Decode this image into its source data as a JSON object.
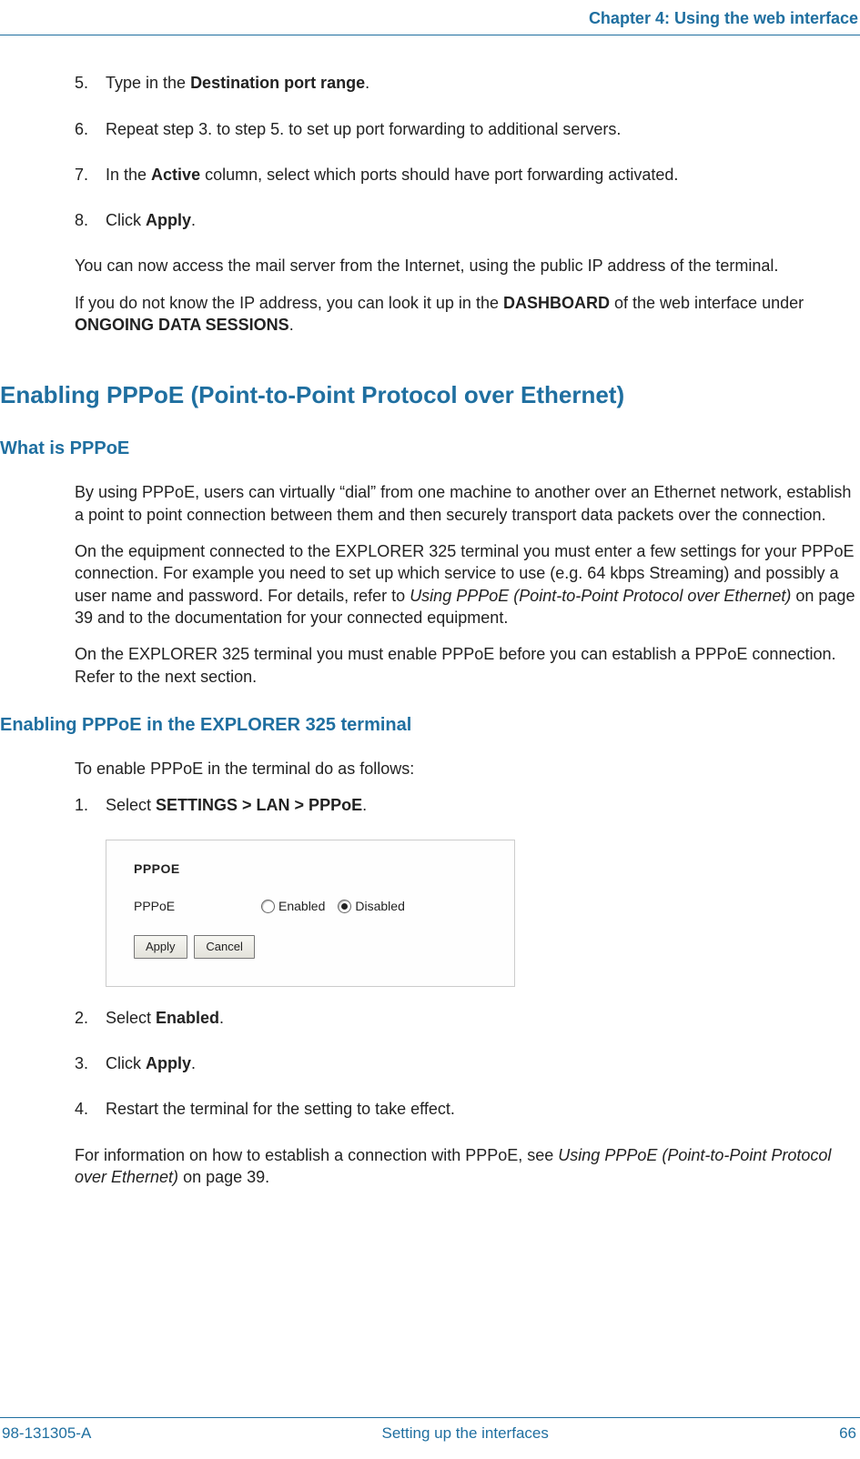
{
  "header": {
    "chapter": "Chapter 4: Using the web interface"
  },
  "steps_a": {
    "s5": {
      "num": "5.",
      "pre": "Type in the ",
      "bold": "Destination port range",
      "post": "."
    },
    "s6": {
      "num": "6.",
      "text": "Repeat step 3. to step 5. to set up port forwarding to additional servers."
    },
    "s7": {
      "num": "7.",
      "pre": "In the ",
      "bold": "Active",
      "post": " column, select which ports should have port forwarding activated."
    },
    "s8": {
      "num": "8.",
      "pre": "Click ",
      "bold": "Apply",
      "post": "."
    }
  },
  "para_a1": "You can now access the mail server from the Internet, using the public IP address of the terminal.",
  "para_a2": {
    "t1": "If you do not know the IP address, you can look it up in the ",
    "b1": "DASHBOARD",
    "t2": " of the web interface under ",
    "b2": "ONGOING DATA SESSIONS",
    "t3": "."
  },
  "section1": "Enabling PPPoE (Point-to-Point Protocol over Ethernet)",
  "sub1": "What is PPPoE",
  "p1": "By using PPPoE, users can virtually “dial” from one machine to another over an Ethernet network, establish a point to point connection between them and then securely transport data packets over the connection.",
  "p2": {
    "t1": "On the equipment connected to the EXPLORER 325 terminal you must enter a few settings for your PPPoE connection. For example you need to set up which service to use (e.g. 64 kbps Streaming) and possibly a user name and password. For details, refer to ",
    "i1": "Using PPPoE (Point-to-Point Protocol over Ethernet)",
    "t2": " on page 39 and to the documentation for your connected equipment."
  },
  "p3": "On the EXPLORER 325 terminal you must enable PPPoE before you can establish a PPPoE connection. Refer to the next section.",
  "sub2": "Enabling PPPoE in the EXPLORER 325 terminal",
  "p4": "To enable PPPoE in the terminal do as follows:",
  "steps_b": {
    "s1": {
      "num": "1.",
      "pre": "Select ",
      "bold": "SETTINGS > LAN > PPPoE",
      "post": "."
    },
    "s2": {
      "num": "2.",
      "pre": "Select ",
      "bold": "Enabled",
      "post": "."
    },
    "s3": {
      "num": "3.",
      "pre": "Click ",
      "bold": "Apply",
      "post": "."
    },
    "s4": {
      "num": "4.",
      "text": "Restart the terminal for the setting to take effect."
    }
  },
  "screenshot": {
    "title": "PPPOE",
    "label": "PPPoE",
    "opt_enabled": "Enabled",
    "opt_disabled": "Disabled",
    "btn_apply": "Apply",
    "btn_cancel": "Cancel"
  },
  "p5": {
    "t1": "For information on how to establish a connection with PPPoE, see ",
    "i1": "Using PPPoE (Point-to-Point Protocol over Ethernet)",
    "t2": " on page 39."
  },
  "footer": {
    "left": "98-131305-A",
    "center": "Setting up the interfaces",
    "right": "66"
  }
}
